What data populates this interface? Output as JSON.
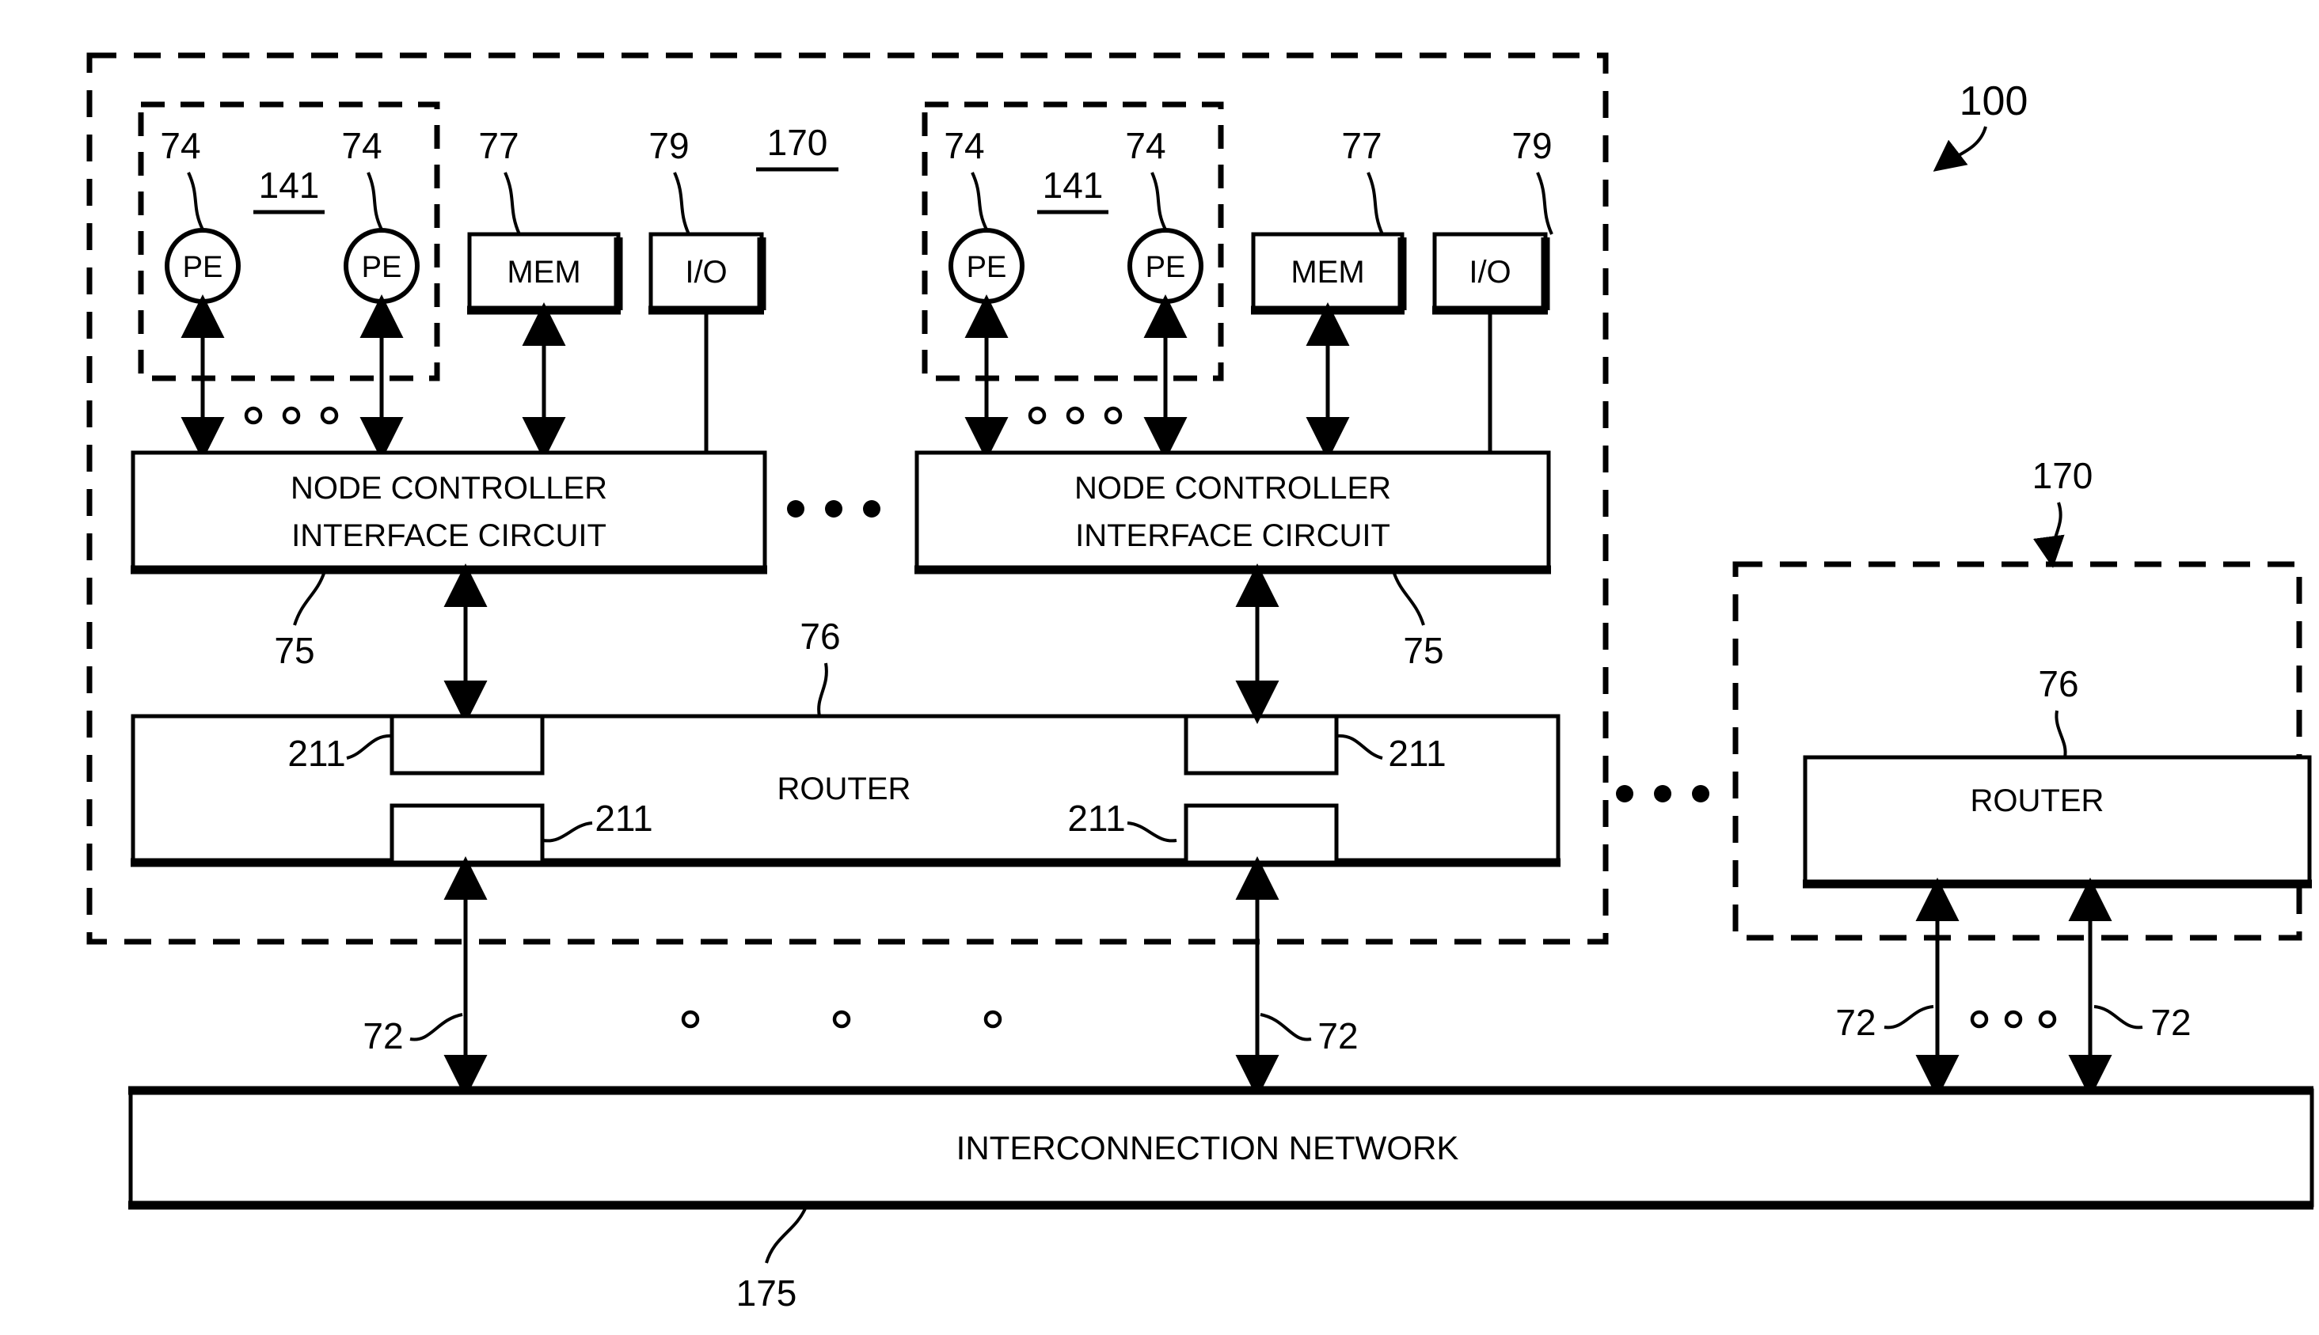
{
  "figure": {
    "title_ref": "100",
    "labels": {
      "pe": "PE",
      "mem": "MEM",
      "io": "I/O",
      "node_controller_line1": "NODE CONTROLLER",
      "node_controller_line2": "INTERFACE CIRCUIT",
      "router": "ROUTER",
      "interconnection_network": "INTERCONNECTION NETWORK"
    },
    "reference_numerals": {
      "system": "100",
      "node": "170",
      "pe_cluster": "141",
      "pe": "74",
      "mem": "77",
      "io": "79",
      "node_controller": "75",
      "router": "76",
      "router_port": "211",
      "network_link": "72",
      "interconnection_network": "175"
    }
  },
  "nodes": [
    {
      "id": "node-1",
      "ref": "170",
      "cluster": {
        "ref": "141",
        "processing_elements": [
          {
            "label": "PE",
            "ref": "74"
          },
          {
            "label": "PE",
            "ref": "74"
          }
        ],
        "ellipsis": "o o o"
      },
      "memory": {
        "label": "MEM",
        "ref": "77"
      },
      "io": {
        "label": "I/O",
        "ref": "79"
      },
      "node_controller": {
        "line1": "NODE CONTROLLER",
        "line2": "INTERFACE CIRCUIT",
        "ref": "75"
      },
      "router": {
        "label": "ROUTER",
        "ref": "76",
        "ports": [
          {
            "ref": "211",
            "position": "top-left"
          },
          {
            "ref": "211",
            "position": "top-right"
          },
          {
            "ref": "211",
            "position": "bottom-left"
          },
          {
            "ref": "211",
            "position": "bottom-right"
          }
        ]
      }
    },
    {
      "id": "node-2",
      "ref": "170",
      "cluster": {
        "ref": "141",
        "processing_elements": [
          {
            "label": "PE",
            "ref": "74"
          },
          {
            "label": "PE",
            "ref": "74"
          }
        ],
        "ellipsis": "o o o"
      },
      "memory": {
        "label": "MEM",
        "ref": "77"
      },
      "io": {
        "label": "I/O",
        "ref": "79"
      },
      "node_controller": {
        "line1": "NODE CONTROLLER",
        "line2": "INTERFACE CIRCUIT",
        "ref": "75"
      }
    },
    {
      "id": "node-n",
      "ref": "170",
      "router": {
        "label": "ROUTER",
        "ref": "76"
      }
    }
  ],
  "network": {
    "label": "INTERCONNECTION NETWORK",
    "ref": "175",
    "links": [
      {
        "ref": "72"
      },
      {
        "ref": "72"
      },
      {
        "ref": "72"
      },
      {
        "ref": "72"
      }
    ]
  },
  "text": {
    "n100": "100",
    "n170": "170",
    "n141": "141",
    "n74": "74",
    "n77": "77",
    "n79": "79",
    "n75": "75",
    "n76": "76",
    "n211": "211",
    "n72": "72",
    "n175": "175",
    "pe": "PE",
    "mem": "MEM",
    "io": "I/O",
    "nc1": "NODE CONTROLLER",
    "nc2": "INTERFACE CIRCUIT",
    "router": "ROUTER",
    "network": "INTERCONNECTION NETWORK"
  },
  "colors": {
    "ink": "#000000",
    "paper": "#ffffff"
  }
}
